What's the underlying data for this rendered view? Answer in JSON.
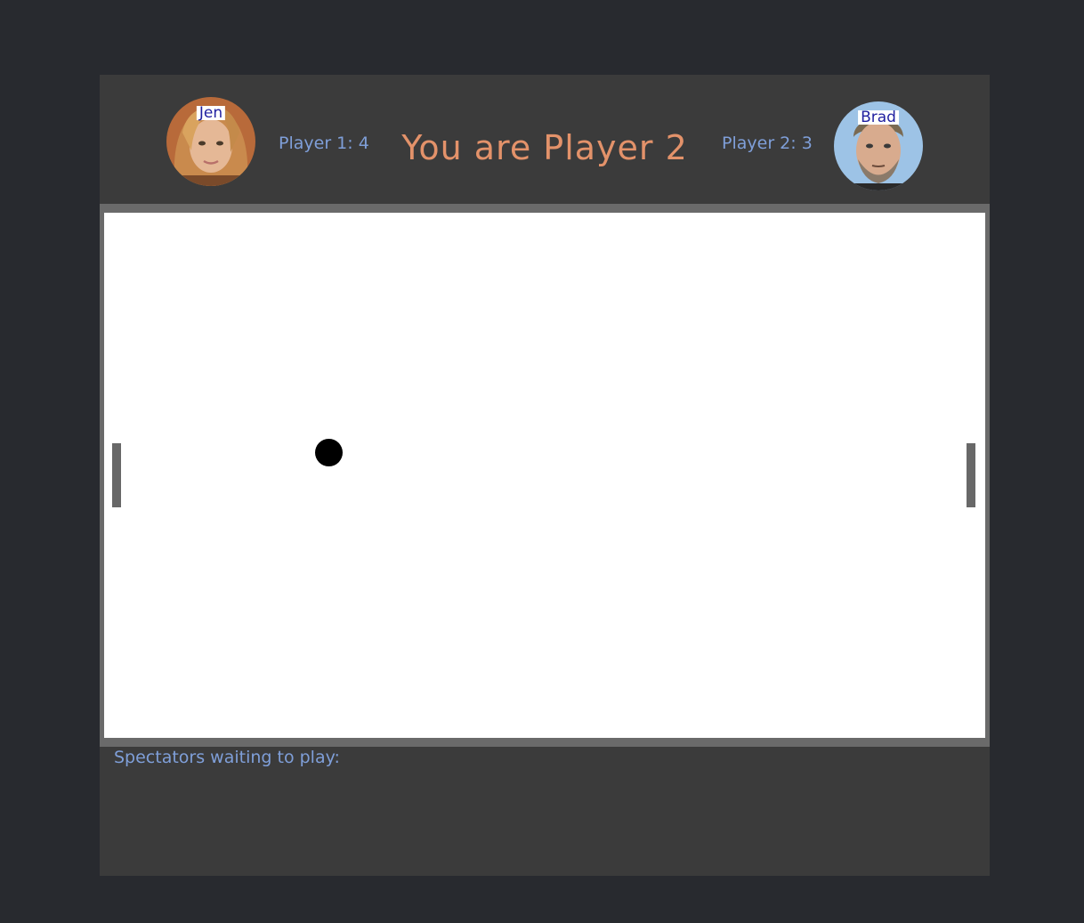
{
  "player1": {
    "name": "Jen",
    "score_text": "Player 1: 4",
    "avatar_icon": "player-photo"
  },
  "player2": {
    "name": "Brad",
    "score_text": "Player 2: 3",
    "avatar_icon": "player-photo"
  },
  "title": "You are Player 2",
  "spectators": {
    "label": "Spectators waiting to play:",
    "list": []
  },
  "colors": {
    "page_background": "#282a2f",
    "panel": "#3b3b3b",
    "title": "#e3926a",
    "score_text": "#7f9fd9",
    "court": "#ffffff",
    "court_border": "#6a6a6a",
    "paddle": "#686868",
    "ball": "#000000"
  }
}
